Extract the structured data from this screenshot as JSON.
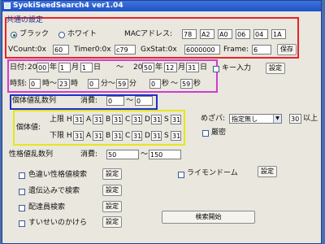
{
  "window": {
    "title": "SyokiSeedSearch4 ver1.04"
  },
  "common": {
    "header": "共通の設定",
    "radio_black": "ブラック",
    "radio_white": "ホワイト",
    "mac_label": "MACアドレス:",
    "mac": [
      "78",
      "A2",
      "A0",
      "06",
      "04",
      "1A"
    ],
    "vcount_label": "VCount:0x",
    "vcount": "60",
    "timer_label": "Timer0:0x",
    "timer": "c79",
    "gxstat_label": "GxStat:0x",
    "gxstat": "6000000",
    "frame_label": "Frame:",
    "frame": "6",
    "save_button": "保存"
  },
  "datetime": {
    "date_label": "日付:",
    "year_prefix": "20",
    "year_from": "00",
    "year_unit": "年",
    "month_from": "1",
    "month_unit": "月",
    "day_from": "1",
    "day_unit": "日",
    "tilde": "～",
    "year_to": "50",
    "month_to": "12",
    "day_to": "31",
    "time_label": "時刻:",
    "hour_from": "0",
    "hour_unit": "時",
    "hour_to": "23",
    "min_from": "0",
    "min_unit": "分",
    "min_to": "59",
    "sec_from": "0",
    "sec_unit": "秒",
    "sec_to": "59",
    "key_input_label": "キー入力",
    "setting_button": "設定"
  },
  "iv_rand": {
    "label": "個体値乱数列",
    "consume_label": "消費:",
    "from": "0",
    "tilde": "～",
    "to": "0"
  },
  "iv": {
    "label": "個体値:",
    "upper_label": "上限 H",
    "lower_label": "下限 H",
    "stat_letters": [
      "A",
      "B",
      "C",
      "D",
      "S"
    ],
    "upper": [
      "31",
      "31",
      "31",
      "31",
      "31",
      "31"
    ],
    "lower": [
      "31",
      "31",
      "31",
      "31",
      "31",
      "31"
    ]
  },
  "awakened": {
    "label": "めざパ:",
    "select_value": "指定無し",
    "power": "30",
    "power_suffix": "以上",
    "strict_label": "厳密"
  },
  "nature_rand": {
    "label": "性格値乱数列",
    "consume_label": "消費:",
    "from": "50",
    "tilde": "～",
    "to": "150"
  },
  "options": {
    "color_diff": "色違い性格値検索",
    "inherit": "遺伝込みで検索",
    "delivery": "配達員検索",
    "sleep": "すいせいのかけら",
    "lymon": "ライモンドーム",
    "setting_button": "設定",
    "search_button": "検索開始"
  },
  "colors": {
    "highlight_common": "#e8232b",
    "highlight_datetime": "#d23bd2",
    "highlight_ivrand": "#1f2fc8",
    "highlight_iv": "#e6e61c"
  }
}
